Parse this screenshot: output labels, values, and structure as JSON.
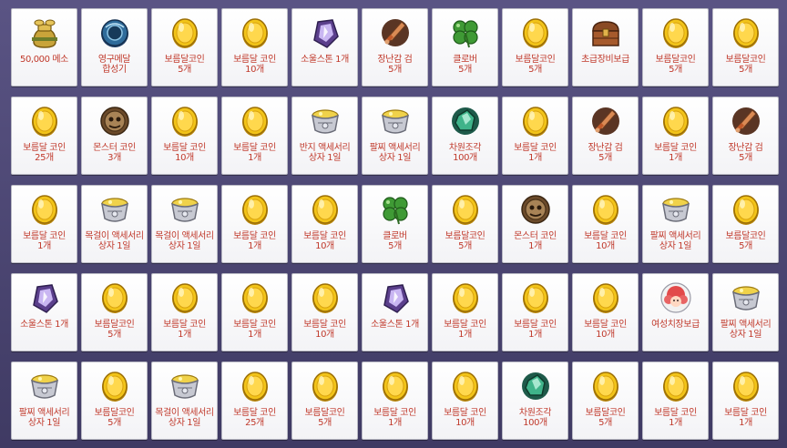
{
  "colors": {
    "label": "#c0392b",
    "slot_bg": "#ffffff",
    "page_bg": "#4a4470"
  },
  "rows": [
    {
      "items": [
        {
          "icon": "mesos-bag-icon",
          "line1": "50,000 메소",
          "line2": ""
        },
        {
          "icon": "medal-compose-icon",
          "line1": "영구메달",
          "line2": "합성기"
        },
        {
          "icon": "coin-icon",
          "line1": "보름달코인",
          "line2": "5개"
        },
        {
          "icon": "coin-icon",
          "line1": "보름달 코인",
          "line2": "10개"
        },
        {
          "icon": "soul-stone-icon",
          "line1": "소울스톤 1개",
          "line2": ""
        },
        {
          "icon": "toy-sword-icon",
          "line1": "장난감 검",
          "line2": "5개"
        },
        {
          "icon": "clover-icon",
          "line1": "클로버",
          "line2": "5개"
        },
        {
          "icon": "coin-icon",
          "line1": "보름달코인",
          "line2": "5개"
        },
        {
          "icon": "treasure-chest-icon",
          "line1": "초급장비보급",
          "line2": ""
        },
        {
          "icon": "coin-icon",
          "line1": "보름달코인",
          "line2": "5개"
        },
        {
          "icon": "coin-icon",
          "line1": "보름달코인",
          "line2": "5개"
        }
      ]
    },
    {
      "items": [
        {
          "icon": "coin-icon",
          "line1": "보름달 코인",
          "line2": "25개"
        },
        {
          "icon": "monster-coin-icon",
          "line1": "몬스터 코인",
          "line2": "3개"
        },
        {
          "icon": "coin-icon",
          "line1": "보름달 코인",
          "line2": "10개"
        },
        {
          "icon": "coin-icon",
          "line1": "보름달 코인",
          "line2": "1개"
        },
        {
          "icon": "accessory-box-icon",
          "line1": "반지 액세서리",
          "line2": "상자 1일"
        },
        {
          "icon": "accessory-box-icon",
          "line1": "팔찌 액세서리",
          "line2": "상자 1일"
        },
        {
          "icon": "dimension-shard-icon",
          "line1": "차원조각",
          "line2": "100개"
        },
        {
          "icon": "coin-icon",
          "line1": "보름달 코인",
          "line2": "1개"
        },
        {
          "icon": "toy-sword-icon",
          "line1": "장난감 검",
          "line2": "5개"
        },
        {
          "icon": "coin-icon",
          "line1": "보름달 코인",
          "line2": "1개"
        },
        {
          "icon": "toy-sword-icon",
          "line1": "장난감 검",
          "line2": "5개"
        }
      ]
    },
    {
      "items": [
        {
          "icon": "coin-icon",
          "line1": "보름달 코인",
          "line2": "1개"
        },
        {
          "icon": "accessory-box-icon",
          "line1": "목걸이 액세서리",
          "line2": "상자 1일"
        },
        {
          "icon": "accessory-box-icon",
          "line1": "목걸이 액세서리",
          "line2": "상자 1일"
        },
        {
          "icon": "coin-icon",
          "line1": "보름달 코인",
          "line2": "1개"
        },
        {
          "icon": "coin-icon",
          "line1": "보름달 코인",
          "line2": "10개"
        },
        {
          "icon": "clover-icon",
          "line1": "클로버",
          "line2": "5개"
        },
        {
          "icon": "coin-icon",
          "line1": "보름달코인",
          "line2": "5개"
        },
        {
          "icon": "monster-coin-icon",
          "line1": "몬스터 코인",
          "line2": "1개"
        },
        {
          "icon": "coin-icon",
          "line1": "보름달 코인",
          "line2": "10개"
        },
        {
          "icon": "accessory-box-icon",
          "line1": "팔찌 액세서리",
          "line2": "상자 1일"
        },
        {
          "icon": "coin-icon",
          "line1": "보름달코인",
          "line2": "5개"
        }
      ]
    },
    {
      "items": [
        {
          "icon": "soul-stone-icon",
          "line1": "소울스톤 1개",
          "line2": ""
        },
        {
          "icon": "coin-icon",
          "line1": "보름달코인",
          "line2": "5개"
        },
        {
          "icon": "coin-icon",
          "line1": "보름달 코인",
          "line2": "1개"
        },
        {
          "icon": "coin-icon",
          "line1": "보름달 코인",
          "line2": "1개"
        },
        {
          "icon": "coin-icon",
          "line1": "보름달 코인",
          "line2": "10개"
        },
        {
          "icon": "soul-stone-icon",
          "line1": "소울스톤 1개",
          "line2": ""
        },
        {
          "icon": "coin-icon",
          "line1": "보름달 코인",
          "line2": "1개"
        },
        {
          "icon": "coin-icon",
          "line1": "보름달 코인",
          "line2": "1개"
        },
        {
          "icon": "coin-icon",
          "line1": "보름달 코인",
          "line2": "10개"
        },
        {
          "icon": "hair-coupon-icon",
          "line1": "여성치장보급",
          "line2": ""
        },
        {
          "icon": "accessory-box-icon",
          "line1": "팔찌 액세서리",
          "line2": "상자 1일"
        }
      ]
    },
    {
      "items": [
        {
          "icon": "accessory-box-icon",
          "line1": "팔찌 액세서리",
          "line2": "상자 1일"
        },
        {
          "icon": "coin-icon",
          "line1": "보름달코인",
          "line2": "5개"
        },
        {
          "icon": "accessory-box-icon",
          "line1": "목걸이 액세서리",
          "line2": "상자 1일"
        },
        {
          "icon": "coin-icon",
          "line1": "보름달 코인",
          "line2": "25개"
        },
        {
          "icon": "coin-icon",
          "line1": "보름달코인",
          "line2": "5개"
        },
        {
          "icon": "coin-icon",
          "line1": "보름달 코인",
          "line2": "1개"
        },
        {
          "icon": "coin-icon",
          "line1": "보름달 코인",
          "line2": "10개"
        },
        {
          "icon": "dimension-shard-icon",
          "line1": "차원조각",
          "line2": "100개"
        },
        {
          "icon": "coin-icon",
          "line1": "보름달코인",
          "line2": "5개"
        },
        {
          "icon": "coin-icon",
          "line1": "보름달 코인",
          "line2": "1개"
        },
        {
          "icon": "coin-icon",
          "line1": "보름달 코인",
          "line2": "1개"
        }
      ]
    }
  ]
}
